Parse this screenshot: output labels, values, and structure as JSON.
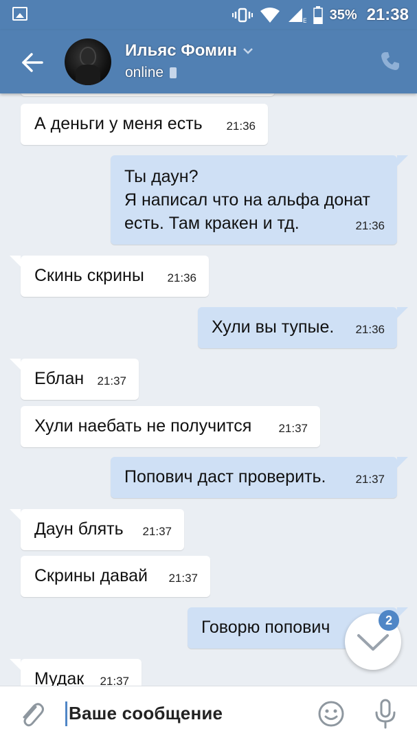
{
  "status_bar": {
    "battery": "35%",
    "time": "21:38",
    "network_label": "E"
  },
  "header": {
    "contact_name": "Ильяс Фомин",
    "status": "online"
  },
  "messages": [
    {
      "direction": "in",
      "text": "А деньги у меня есть",
      "time": "21:36"
    },
    {
      "direction": "out",
      "text": "Ты даун?\nЯ написал что на альфа донат\nесть. Там кракен  и тд.",
      "time": "21:36"
    },
    {
      "direction": "in",
      "text": "Скинь скрины",
      "time": "21:36"
    },
    {
      "direction": "out",
      "text": "Хули вы тупые.",
      "time": "21:36"
    },
    {
      "direction": "in",
      "text": "Еблан",
      "time": "21:37"
    },
    {
      "direction": "in",
      "text": "Хули наебать не получится",
      "time": "21:37"
    },
    {
      "direction": "out",
      "text": "Попович даст проверить.",
      "time": "21:37"
    },
    {
      "direction": "in",
      "text": "Даун блять",
      "time": "21:37"
    },
    {
      "direction": "in",
      "text": "Скрины давай",
      "time": "21:37"
    },
    {
      "direction": "out",
      "text": "Говорю попович",
      "time": ""
    },
    {
      "direction": "in",
      "text": "Мудак",
      "time": "21:37"
    }
  ],
  "scroll_fab": {
    "unread_count": "2"
  },
  "input": {
    "placeholder": "Ваше сообщение",
    "value": ""
  },
  "colors": {
    "header": "#5180b3",
    "background": "#eaeef3",
    "incoming_bubble": "#ffffff",
    "outgoing_bubble": "#cfe0f5",
    "accent": "#4f86c6"
  }
}
